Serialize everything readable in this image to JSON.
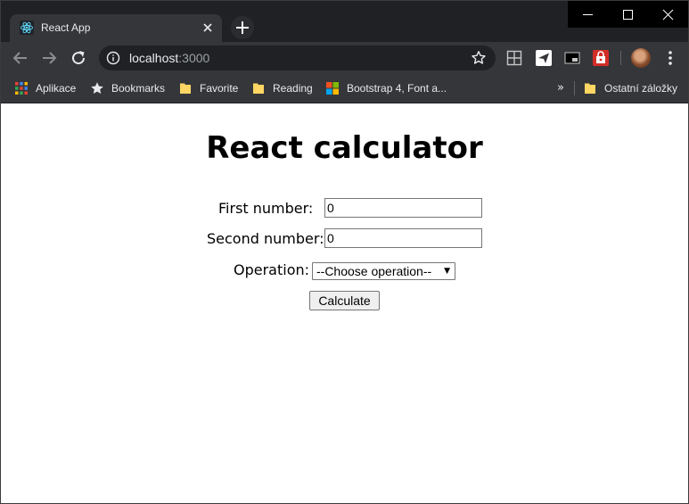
{
  "window": {
    "tab_title": "React App",
    "tab_favicon": "react-logo-icon",
    "controls": [
      "minimize-icon",
      "maximize-icon",
      "close-icon"
    ]
  },
  "toolbar": {
    "url_host": "localhost",
    "url_port": ":3000",
    "icons": [
      "back-arrow-icon",
      "forward-arrow-icon",
      "reload-icon",
      "site-info-icon",
      "bookmark-star-icon",
      "grid-extension-icon",
      "send-extension-icon",
      "picture-in-picture-icon",
      "lastpass-extension-icon",
      "profile-avatar",
      "menu-dots-icon"
    ]
  },
  "bookmarks": {
    "items": [
      {
        "label": "Aplikace",
        "icon": "apps-grid-icon"
      },
      {
        "label": "Bookmarks",
        "icon": "star-icon"
      },
      {
        "label": "Favorite",
        "icon": "folder-icon"
      },
      {
        "label": "Reading",
        "icon": "folder-icon"
      },
      {
        "label": "Bootstrap 4, Font a...",
        "icon": "windows-logo-icon"
      }
    ],
    "more": "»",
    "other": {
      "label": "Ostatní záložky",
      "icon": "folder-icon"
    }
  },
  "page": {
    "title": "React calculator",
    "first_label": "First number:",
    "first_value": "0",
    "second_label": "Second number:",
    "second_value": "0",
    "operation_label": "Operation:",
    "operation_selected": "--Choose operation--",
    "calculate_label": "Calculate"
  },
  "colors": {
    "chrome_dark": "#202124",
    "chrome_toolbar": "#35363a",
    "text_light": "#e8eaed",
    "folder_yellow": "#fdd663"
  }
}
